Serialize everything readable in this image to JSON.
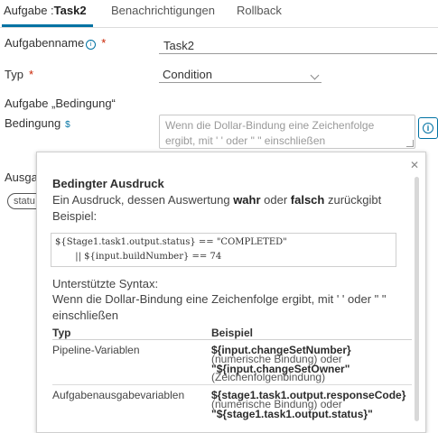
{
  "tabs": [
    {
      "prefix": "Aufgabe :",
      "name": "Task2"
    },
    {
      "label": "Benachrichtigungen"
    },
    {
      "label": "Rollback"
    }
  ],
  "form": {
    "task_name_label": "Aufgabenname",
    "task_name_value": "Task2",
    "type_label": "Typ",
    "type_value": "Condition",
    "section_heading": "Aufgabe „Bedingung“",
    "condition_label": "Bedingung",
    "condition_placeholder_line1": "Wenn die Dollar-Bindung eine Zeichenfolge",
    "condition_placeholder_line2": "ergibt, mit ' ' oder \" \" einschließen",
    "output_label_partial": "Ausga",
    "output_chip_partial": "statu",
    "required_mark": "*"
  },
  "popover": {
    "title": "Bedingter Ausdruck",
    "desc_pre": "Ein Ausdruck, dessen Auswertung ",
    "desc_true": "wahr",
    "desc_mid": " oder ",
    "desc_false": "falsch",
    "desc_post": " zurückgibt",
    "example_label": "Beispiel:",
    "code_line1": "${Stage1.task1.output.status} == \"COMPLETED\"",
    "code_line2": "       || ${input.buildNumber} == 74",
    "supported_label": "Unterstützte Syntax:",
    "supported_line1": "Wenn die Dollar-Bindung eine Zeichenfolge ergibt, mit ' ' oder \" \"",
    "supported_line2": "einschließen",
    "col_type": "Typ",
    "col_example": "Beispiel",
    "rows": [
      {
        "type": "Pipeline-Variablen",
        "ex1": "${input.changeSetNumber}",
        "note1": "(numerische Bindung) oder",
        "ex2": "\"${input.changeSetOwner\"",
        "note2": "(Zeichenfolgenbindung)"
      },
      {
        "type": "Aufgabenausgabevariablen",
        "ex1": "${stage1.task1.output.responseCode}",
        "note1": "(numerische Bindung) oder",
        "ex2": "\"${stage1.task1.output.status}\""
      }
    ]
  },
  "colors": {
    "accent": "#0072a3",
    "required": "#c92100"
  }
}
